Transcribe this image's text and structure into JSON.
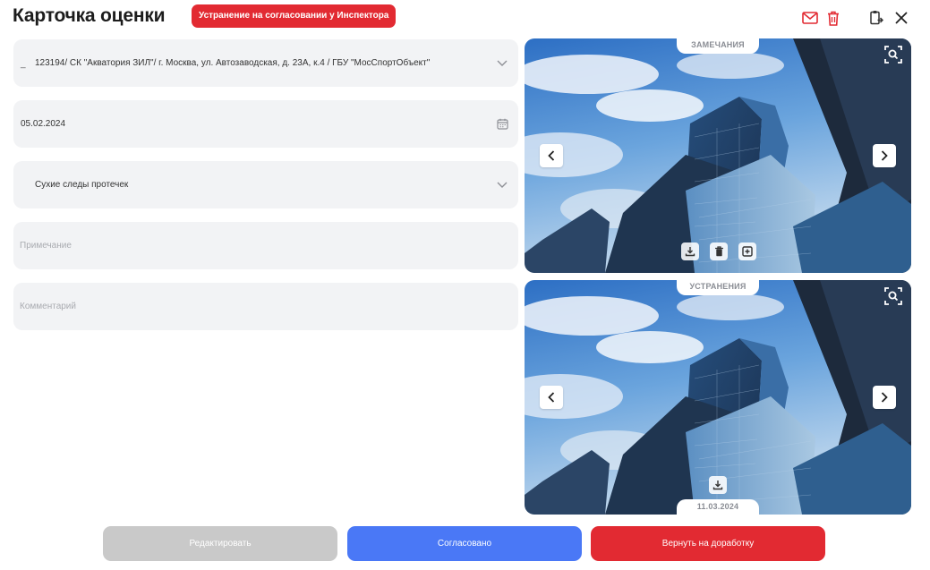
{
  "header": {
    "title": "Карточка оценки",
    "status_badge": "Устранение на согласовании у Инспектора",
    "icons": [
      "mail-icon",
      "trash-icon",
      "clipboard-icon",
      "close-icon"
    ],
    "accent_color": "#e22a32"
  },
  "form": {
    "object": {
      "dash": "_",
      "value": "123194/ СК \"Акватория ЗИЛ\"/ г. Москва, ул. Автозаводская, д. 23А, к.4 / ГБУ \"МосСпортОбъект\""
    },
    "date": {
      "value": "05.02.2024"
    },
    "defect": {
      "value": "Сухие следы протечек"
    },
    "note": {
      "placeholder": "Примечание"
    },
    "comment": {
      "placeholder": "Комментарий"
    }
  },
  "photos": {
    "remarks": {
      "label": "ЗАМЕЧАНИЯ"
    },
    "fixes": {
      "label": "УСТРАНЕНИЯ",
      "date": "11.03.2024"
    }
  },
  "actions": {
    "edit": "Редактировать",
    "agree": "Согласовано",
    "return": "Вернуть на доработку"
  },
  "colors": {
    "primary": "#4a78f6",
    "danger": "#e22a32",
    "disabled": "#c9c9c9",
    "field_bg": "#f2f3f5"
  }
}
